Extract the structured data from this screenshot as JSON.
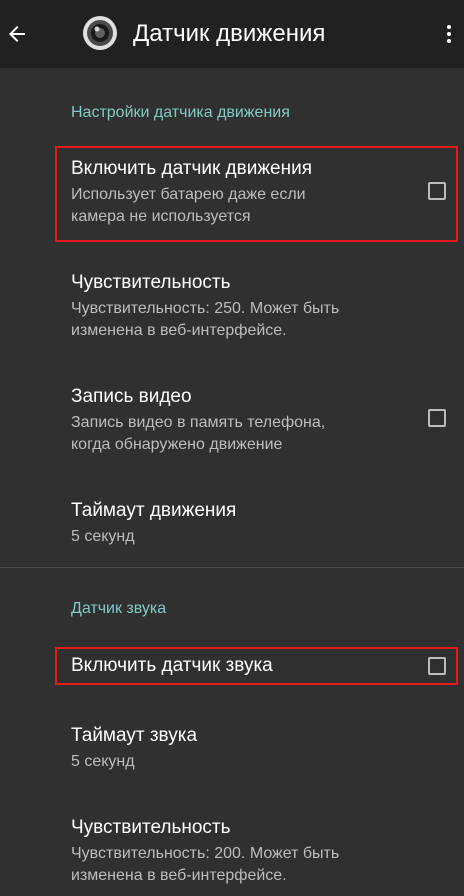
{
  "toolbar": {
    "title": "Датчик движения",
    "back_icon": "arrow-left-icon",
    "logo_icon": "camera-lens-icon",
    "overflow_icon": "more-vert-icon"
  },
  "sections": {
    "motion": {
      "header": "Настройки датчика движения",
      "enable_motion": {
        "title": "Включить датчик движения",
        "summary": "Использует батарею даже если\nкамера не используется",
        "checked": false
      },
      "sensitivity": {
        "title": "Чувствительность",
        "summary": "Чувствительность: 250. Может быть\nизменена в веб-интерфейсе."
      },
      "record_video": {
        "title": "Запись видео",
        "summary": "Запись видео в память телефона,\nкогда обнаружено движение",
        "checked": false
      },
      "timeout": {
        "title": "Таймаут движения",
        "summary": "5 секунд"
      }
    },
    "sound": {
      "header": "Датчик звука",
      "enable_sound": {
        "title": "Включить датчик звука",
        "checked": false
      },
      "timeout": {
        "title": "Таймаут звука",
        "summary": "5 секунд"
      },
      "sensitivity": {
        "title": "Чувствительность",
        "summary": "Чувствительность: 200. Может быть\nизменена в веб-интерфейсе."
      }
    }
  },
  "colors": {
    "background": "#303030",
    "toolbar": "#212121",
    "accent": "#80cbc4",
    "highlight": "#e5191c"
  }
}
